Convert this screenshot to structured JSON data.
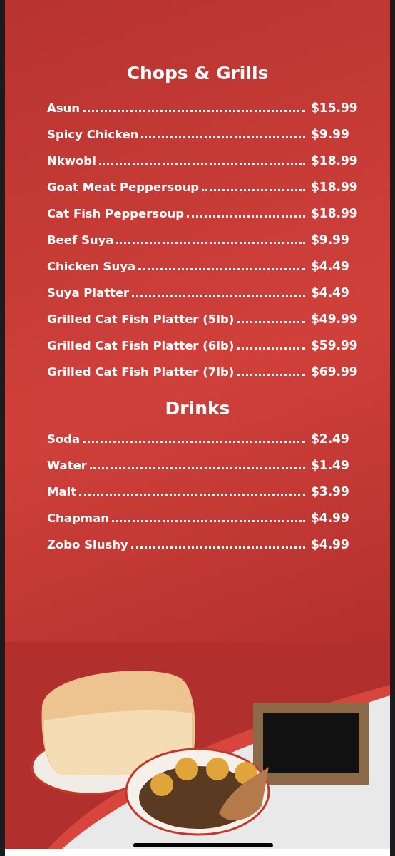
{
  "sections": [
    {
      "title": "Chops & Grills",
      "items": [
        {
          "name": "Asun",
          "price": "$15.99"
        },
        {
          "name": "Spicy Chicken",
          "price": "$9.99"
        },
        {
          "name": "Nkwobi",
          "price": "$18.99"
        },
        {
          "name": "Goat Meat Peppersoup",
          "price": "$18.99"
        },
        {
          "name": "Cat Fish Peppersoup",
          "price": "$18.99"
        },
        {
          "name": "Beef Suya",
          "price": "$9.99"
        },
        {
          "name": "Chicken Suya",
          "price": "$4.49"
        },
        {
          "name": "Suya Platter",
          "price": "$4.49"
        },
        {
          "name": "Grilled Cat Fish Platter (5lb)",
          "price": "$49.99"
        },
        {
          "name": "Grilled Cat Fish Platter (6lb)",
          "price": "$59.99"
        },
        {
          "name": "Grilled Cat Fish Platter (7lb)",
          "price": "$69.99"
        }
      ]
    },
    {
      "title": "Drinks",
      "items": [
        {
          "name": "Soda",
          "price": "$2.49"
        },
        {
          "name": "Water",
          "price": "$1.49"
        },
        {
          "name": "Malt",
          "price": "$3.99"
        },
        {
          "name": "Chapman",
          "price": "$4.99"
        },
        {
          "name": "Zobo Slushy",
          "price": "$4.99"
        }
      ]
    }
  ]
}
